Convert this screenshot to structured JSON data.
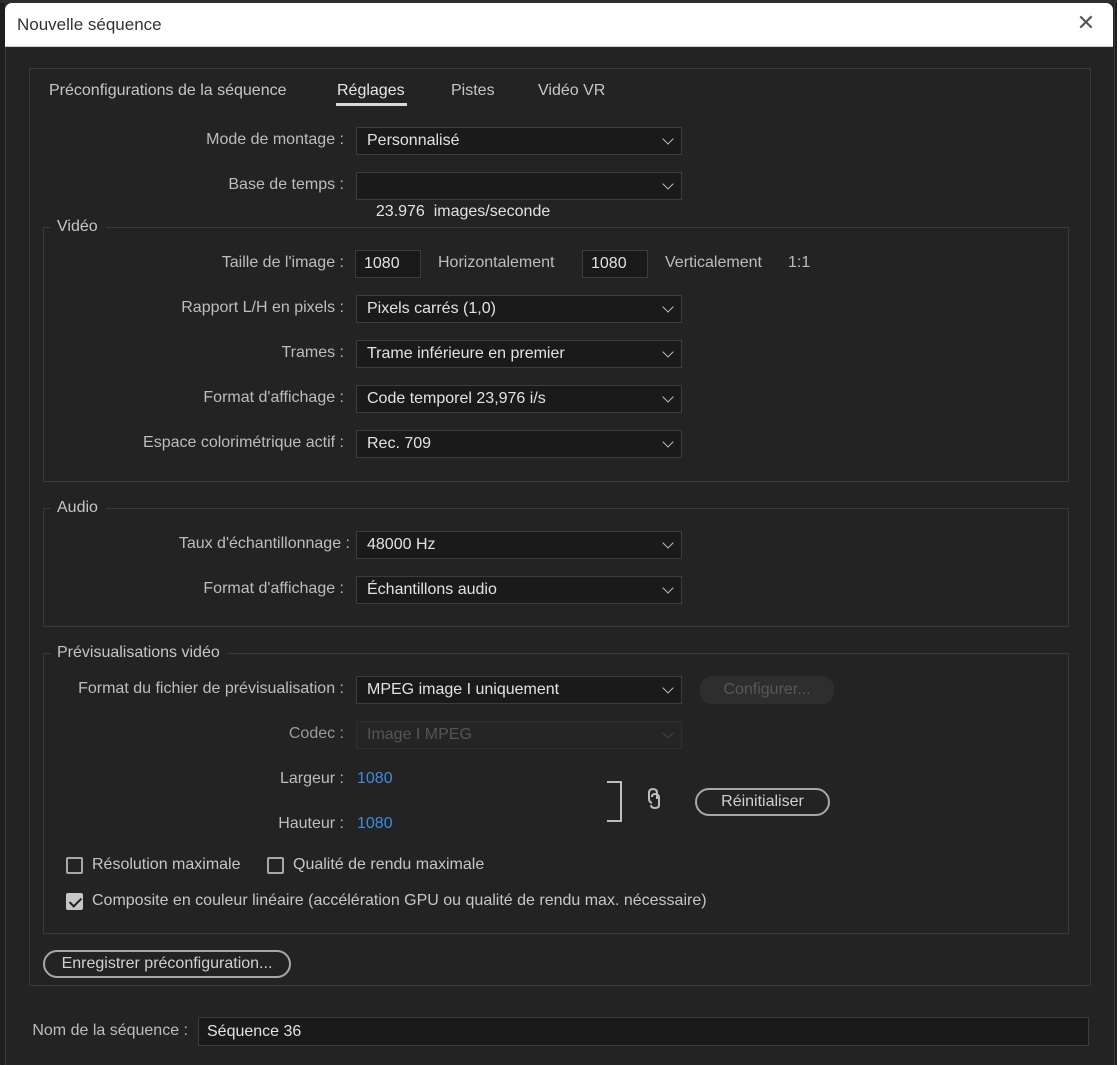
{
  "dialog": {
    "title": "Nouvelle séquence"
  },
  "tabs": [
    {
      "label": "Préconfigurations de la séquence"
    },
    {
      "label": "Réglages"
    },
    {
      "label": "Pistes"
    },
    {
      "label": "Vidéo VR"
    }
  ],
  "general": {
    "edit_mode_label": "Mode de montage :",
    "edit_mode_value": "Personnalisé",
    "timebase_label": "Base de temps :",
    "timebase_value": "23.976  images/seconde"
  },
  "video": {
    "legend": "Vidéo",
    "frame_size_label": "Taille de l'image :",
    "frame_width": "1080",
    "horizontal_label": "Horizontalement",
    "frame_height": "1080",
    "vertical_label": "Verticalement",
    "aspect": "1:1",
    "pixel_aspect_label": "Rapport L/H en pixels :",
    "pixel_aspect_value": "Pixels carrés (1,0)",
    "fields_label": "Trames :",
    "fields_value": "Trame inférieure en premier",
    "display_format_label": "Format d'affichage :",
    "display_format_value": "Code temporel 23,976 i/s",
    "color_space_label": "Espace colorimétrique actif :",
    "color_space_value": "Rec. 709"
  },
  "audio": {
    "legend": "Audio",
    "sample_rate_label": "Taux d'échantillonnage :",
    "sample_rate_value": "48000 Hz",
    "display_format_label": "Format d'affichage :",
    "display_format_value": "Échantillons audio"
  },
  "previews": {
    "legend": "Prévisualisations vidéo",
    "file_format_label": "Format du fichier de prévisualisation :",
    "file_format_value": "MPEG image I uniquement",
    "configure_label": "Configurer...",
    "codec_label": "Codec :",
    "codec_value": "Image I MPEG",
    "width_label": "Largeur :",
    "width_value": "1080",
    "height_label": "Hauteur :",
    "height_value": "1080",
    "reset_label": "Réinitialiser"
  },
  "options": {
    "max_resolution_label": "Résolution maximale",
    "max_resolution_checked": false,
    "max_quality_label": "Qualité de rendu maximale",
    "max_quality_checked": false,
    "linear_composite_label": "Composite en couleur linéaire (accélération GPU ou qualité de rendu max. nécessaire)",
    "linear_composite_checked": true
  },
  "save_preset_label": "Enregistrer préconfiguration...",
  "sequence_name": {
    "label": "Nom de la séquence :",
    "value": "Séquence 36"
  },
  "colors": {
    "accent_blue": "#3d8ce0",
    "panel_bg": "#232323",
    "field_bg": "#1a1a1a"
  }
}
